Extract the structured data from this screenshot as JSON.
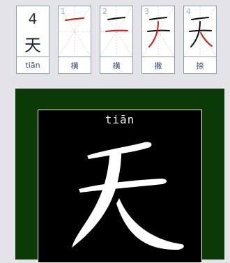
{
  "character": {
    "stroke_count": "4",
    "char": "天",
    "pinyin": "tiān"
  },
  "steps": [
    {
      "index": "1",
      "name": "横"
    },
    {
      "index": "2",
      "name": "横"
    },
    {
      "index": "3",
      "name": "撇"
    },
    {
      "index": "4",
      "name": "捺"
    }
  ],
  "colors": {
    "active_stroke": "#c81e1e",
    "done_stroke": "#111111",
    "board_bg": "#0b3a06",
    "panel_bg": "#000000",
    "glyph": "#ffffff"
  }
}
